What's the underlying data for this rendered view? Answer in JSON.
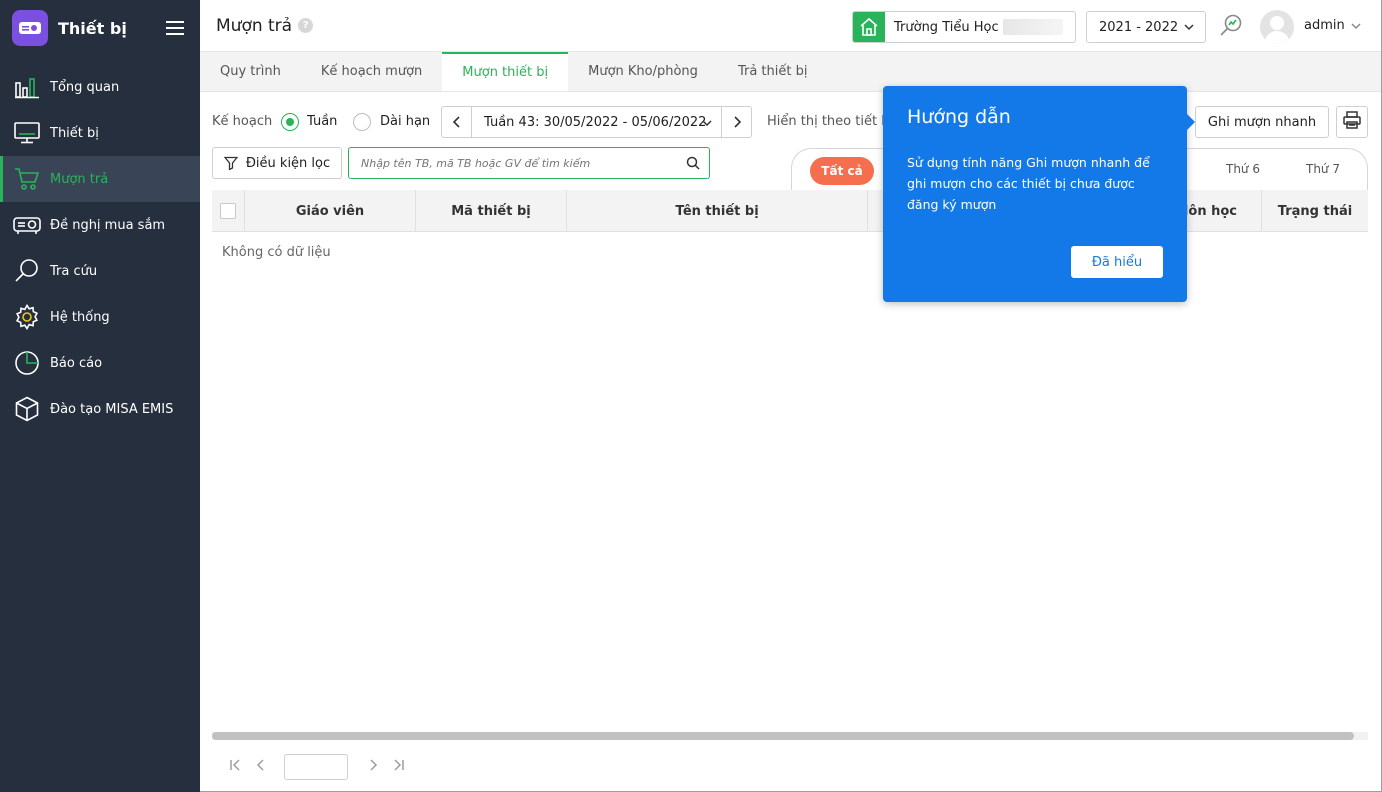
{
  "sidebar": {
    "app_title": "Thiết bị",
    "items": [
      {
        "label": "Tổng quan",
        "icon": "bar-chart-icon"
      },
      {
        "label": "Thiết bị",
        "icon": "monitor-icon"
      },
      {
        "label": "Mượn trả",
        "icon": "cart-icon",
        "active": true
      },
      {
        "label": "Đề nghị mua sắm",
        "icon": "projector-icon"
      },
      {
        "label": "Tra cứu",
        "icon": "search-icon"
      },
      {
        "label": "Hệ thống",
        "icon": "gear-icon"
      },
      {
        "label": "Báo cáo",
        "icon": "pie-chart-icon"
      },
      {
        "label": "Đào tạo MISA EMIS",
        "icon": "cube-icon"
      }
    ]
  },
  "header": {
    "page_title": "Mượn trả",
    "help": "?",
    "school": "Trường Tiểu Học",
    "school_year": "2021 - 2022",
    "user": "admin"
  },
  "tabs": [
    "Quy trình",
    "Kế hoạch mượn",
    "Mượn thiết bị",
    "Mượn Kho/phòng",
    "Trả thiết bị"
  ],
  "toolbar": {
    "plan_label": "Kế hoạch",
    "radio_week": "Tuần",
    "radio_long": "Dài hạn",
    "week_range": "Tuần 43: 30/05/2022 - 05/06/2022",
    "display_by": "Hiển thị theo tiết họ",
    "quick_borrow": "Ghi mượn nhanh"
  },
  "filter": {
    "button": "Điều kiện lọc",
    "search_placeholder": "Nhập tên TB, mã TB hoặc GV để tìm kiếm"
  },
  "day_tabs": {
    "all": "Tất cả",
    "fri": "Thứ 6",
    "sat": "Thứ 7"
  },
  "table": {
    "columns": [
      "Giáo viên",
      "Mã thiết bị",
      "Tên thiết bị",
      "Môn học",
      "Trạng thái"
    ],
    "empty": "Không có dữ liệu"
  },
  "guide": {
    "title": "Hướng dẫn",
    "text": "Sử dụng tính năng Ghi mượn nhanh để ghi mượn cho các thiết bị chưa được đăng ký mượn",
    "ok": "Đã hiểu"
  },
  "colors": {
    "sidebar_bg": "#262f3d",
    "accent_green": "#29b35a",
    "popup_blue": "#1479e8",
    "pill_orange": "#f56e4e"
  }
}
